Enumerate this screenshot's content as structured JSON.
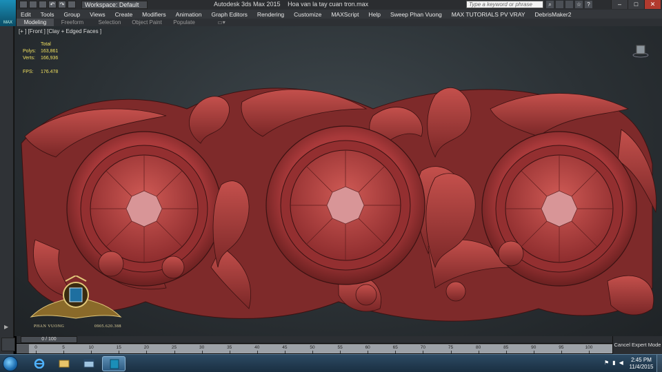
{
  "titlebar": {
    "logo_label": "MAX",
    "workspace": "Workspace: Default",
    "app_name": "Autodesk 3ds Max  2015",
    "file_name": "Hoa van la tay cuan tron.max",
    "search_placeholder": "Type a keyword or phrase"
  },
  "menu": [
    "Edit",
    "Tools",
    "Group",
    "Views",
    "Create",
    "Modifiers",
    "Animation",
    "Graph Editors",
    "Rendering",
    "Customize",
    "MAXScript",
    "Help",
    "Sweep Phan Vuong",
    "MAX TUTORIALS PV VRAY",
    "DebrisMaker2"
  ],
  "ribbon_tabs": [
    "Modeling",
    "Freeform",
    "Selection",
    "Object Paint",
    "Populate"
  ],
  "viewport": {
    "label": "[+ ] [Front ] [Clay + Edged Faces ]",
    "stats_header": "Total",
    "polys_label": "Polys:",
    "polys_value": "163,861",
    "verts_label": "Verts:",
    "verts_value": "166,936",
    "fps_label": "FPS:",
    "fps_value": "176.478"
  },
  "watermark": {
    "name": "PHAN VUONG",
    "phone": "0905.620.388"
  },
  "timeline": {
    "frame_counter": "0 / 100",
    "ticks": [
      "0",
      "5",
      "10",
      "15",
      "20",
      "25",
      "30",
      "35",
      "40",
      "45",
      "50",
      "55",
      "60",
      "65",
      "70",
      "75",
      "80",
      "85",
      "90",
      "95",
      "100"
    ]
  },
  "cancel_expert": "Cancel Expert Mode",
  "taskbar": {
    "time": "2:45 PM",
    "date": "11/4/2015"
  },
  "colors": {
    "model_red": "#a8393a",
    "viewport_bg": "#2b3135",
    "stats_yellow": "#f0e060"
  }
}
